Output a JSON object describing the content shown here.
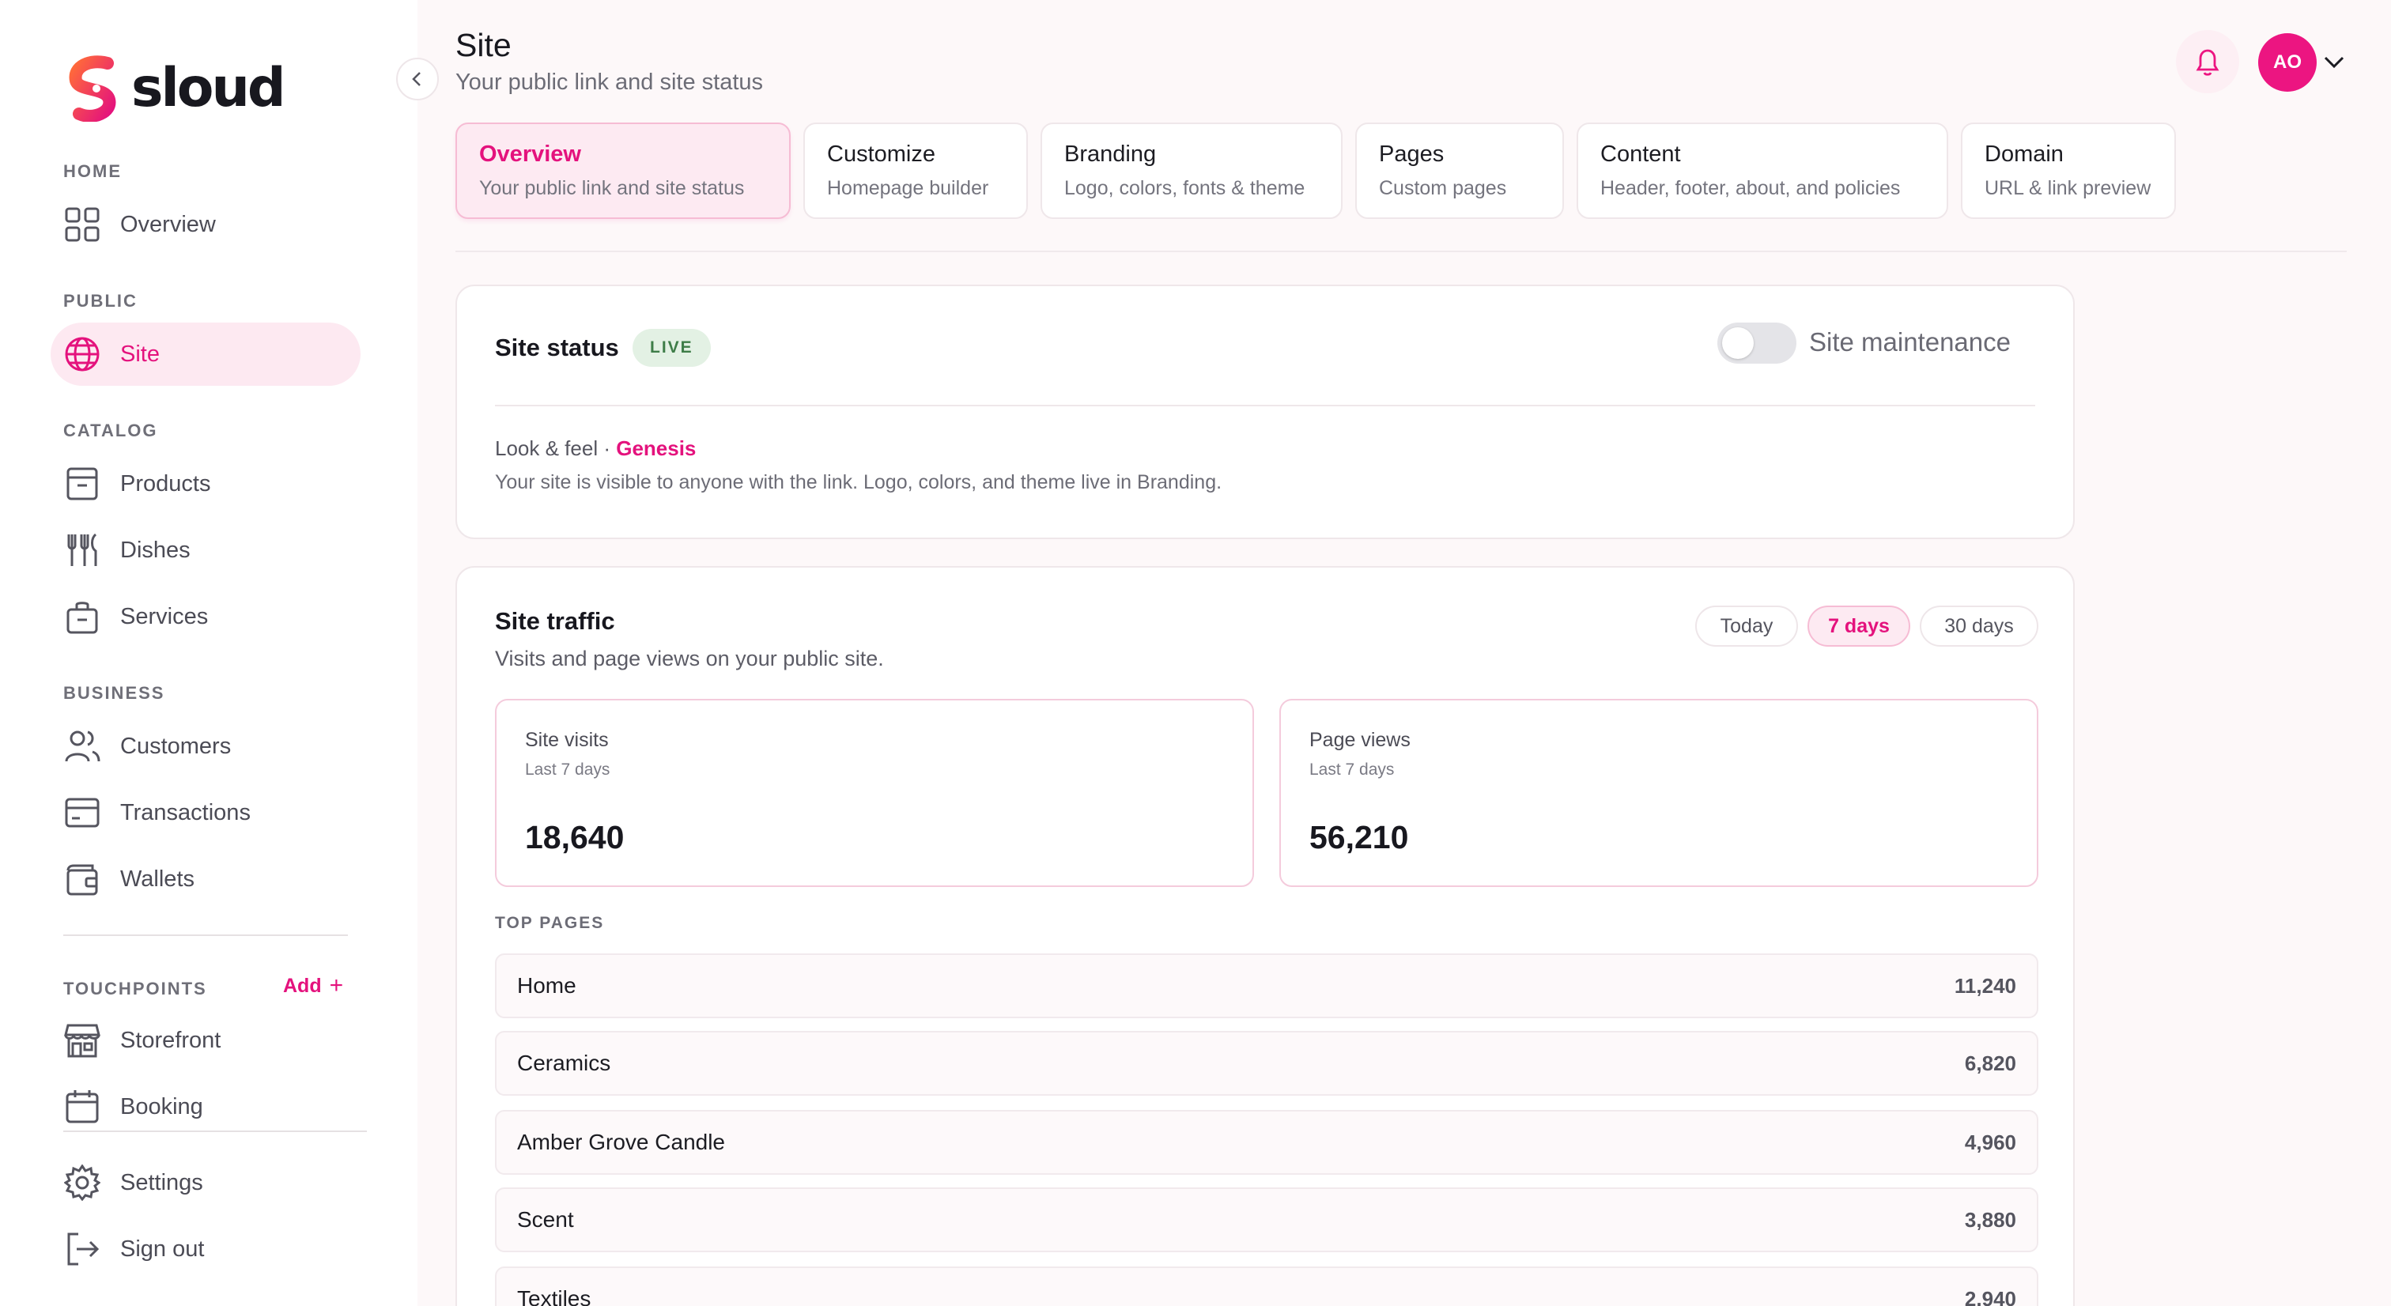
{
  "brand": {
    "name": "sloud",
    "accent": "#e4127d",
    "gradient": [
      "#ff5a3c",
      "#e4127d"
    ]
  },
  "sidebar": {
    "sections": {
      "home": "HOME",
      "public": "PUBLIC",
      "catalog": "CATALOG",
      "business": "BUSINESS",
      "touchpoints": "TOUCHPOINTS"
    },
    "items": {
      "overview": {
        "label": "Overview",
        "icon": "grid-icon"
      },
      "site": {
        "label": "Site",
        "icon": "globe-icon"
      },
      "products": {
        "label": "Products",
        "icon": "archive-box-icon"
      },
      "dishes": {
        "label": "Dishes",
        "icon": "fork-knife-icon"
      },
      "services": {
        "label": "Services",
        "icon": "briefcase-icon"
      },
      "customers": {
        "label": "Customers",
        "icon": "users-icon"
      },
      "transactions": {
        "label": "Transactions",
        "icon": "card-icon"
      },
      "wallets": {
        "label": "Wallets",
        "icon": "wallet-icon"
      },
      "storefront": {
        "label": "Storefront",
        "icon": "store-icon"
      },
      "booking": {
        "label": "Booking",
        "icon": "calendar-icon"
      },
      "settings": {
        "label": "Settings",
        "icon": "gear-icon"
      },
      "signout": {
        "label": "Sign out",
        "icon": "sign-out-icon"
      }
    },
    "add_label": "Add",
    "add_symbol": "+"
  },
  "header": {
    "title": "Site",
    "subtitle": "Your public link and site status",
    "avatar_initials": "AO"
  },
  "tabs": [
    {
      "title": "Overview",
      "subtitle": "Your public link and site status"
    },
    {
      "title": "Customize",
      "subtitle": "Homepage builder"
    },
    {
      "title": "Branding",
      "subtitle": "Logo, colors, fonts & theme"
    },
    {
      "title": "Pages",
      "subtitle": "Custom pages"
    },
    {
      "title": "Content",
      "subtitle": "Header, footer, about, and policies"
    },
    {
      "title": "Domain",
      "subtitle": "URL & link preview"
    }
  ],
  "site_status": {
    "title": "Site status",
    "badge": "LIVE",
    "maintenance_label": "Site maintenance",
    "maintenance_on": false,
    "look_prefix": "Look & feel ·",
    "theme_name": "Genesis",
    "description": "Your site is visible to anyone with the link. Logo, colors, and theme live in Branding."
  },
  "traffic": {
    "title": "Site traffic",
    "subtitle": "Visits and page views on your public site.",
    "ranges": [
      "Today",
      "7 days",
      "30 days"
    ],
    "selected_range": "7 days",
    "stats": [
      {
        "label": "Site visits",
        "period": "Last 7 days",
        "value": "18,640"
      },
      {
        "label": "Page views",
        "period": "Last 7 days",
        "value": "56,210"
      }
    ],
    "top_pages_label": "TOP PAGES",
    "top_pages": [
      {
        "name": "Home",
        "count": "11,240"
      },
      {
        "name": "Ceramics",
        "count": "6,820"
      },
      {
        "name": "Amber Grove Candle",
        "count": "4,960"
      },
      {
        "name": "Scent",
        "count": "3,880"
      },
      {
        "name": "Textiles",
        "count": "2,940"
      }
    ]
  }
}
